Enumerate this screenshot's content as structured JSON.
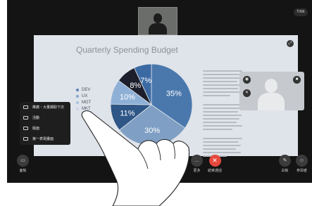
{
  "top_badge": "TIME",
  "slide": {
    "title": "Quarterly Spending Budget",
    "corner_icon": "expand-icon"
  },
  "chart_data": {
    "type": "pie",
    "title": "Quarterly Spending Budget",
    "categories": [
      "DEV",
      "UX",
      "MGT",
      "MKT"
    ],
    "legend": [
      "DEV",
      "UX",
      "MGT",
      "MKT"
    ],
    "slices": [
      {
        "label": "35%",
        "value": 35,
        "color": "#4a78ad"
      },
      {
        "label": "30%",
        "value": 30,
        "color": "#7f9fc4"
      },
      {
        "label": "11%",
        "value": 11,
        "color": "#2e5686"
      },
      {
        "label": "10%",
        "value": 10,
        "color": "#8fb0d6"
      },
      {
        "label": "8%",
        "value": 8,
        "color": "#1d1f2c"
      },
      {
        "label": "7%",
        "value": 7,
        "color": "#3b6aa3"
      }
    ],
    "legend_colors": [
      "#5a82b5",
      "#86a6cb",
      "#a9c3e2",
      "#c7d7ea"
    ],
    "legend_placement": "left"
  },
  "menu": {
    "items": [
      {
        "icon": "share-screen-icon",
        "label": "推廣・大量擷取下次"
      },
      {
        "icon": "record-icon",
        "label": "活動"
      },
      {
        "icon": "layout-icon",
        "label": "版面"
      },
      {
        "icon": "whiteboard-icon",
        "label": "第一表現畫面"
      }
    ]
  },
  "toolbar": {
    "left_label": "面板",
    "mic_label": "",
    "more_label": "更多",
    "end_label": "結束通話",
    "draw_label": "白板",
    "participants_label": "參與者"
  }
}
